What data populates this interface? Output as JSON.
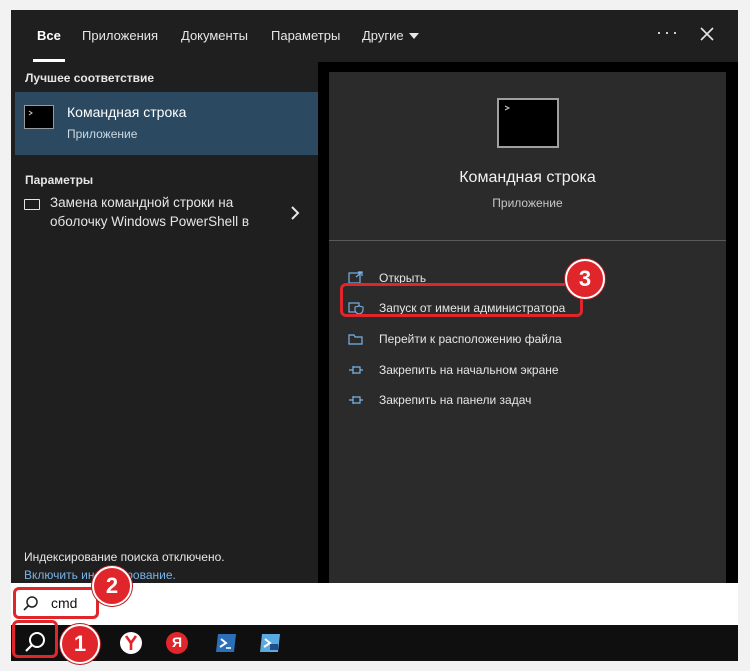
{
  "tabs": [
    {
      "label": "Все",
      "active": true
    },
    {
      "label": "Приложения"
    },
    {
      "label": "Документы"
    },
    {
      "label": "Параметры"
    },
    {
      "label": "Другие"
    }
  ],
  "left": {
    "best_match_heading": "Лучшее соответствие",
    "best_match": {
      "title": "Командная строка",
      "subtitle": "Приложение",
      "icon": "command-prompt-icon"
    },
    "settings_heading": "Параметры",
    "setting_item": {
      "text": "Замена командной строки на оболочку Windows PowerShell в",
      "icon": "monitor-icon"
    },
    "index_notice": "Индексирование поиска отключено.",
    "index_link": "Включить индексирование."
  },
  "right": {
    "app_title": "Командная строка",
    "app_subtitle": "Приложение",
    "actions": [
      {
        "label": "Открыть",
        "icon": "open-icon"
      },
      {
        "label": "Запуск от имени администратора",
        "icon": "shield-icon"
      },
      {
        "label": "Перейти к расположению файла",
        "icon": "folder-icon"
      },
      {
        "label": "Закрепить на начальном экране",
        "icon": "pin-icon"
      },
      {
        "label": "Закрепить на панели задач",
        "icon": "pin-icon"
      }
    ]
  },
  "search": {
    "value": "cmd",
    "icon": "search-icon"
  },
  "taskbar": [
    {
      "name": "search-icon"
    },
    {
      "name": "yandex-browser-icon"
    },
    {
      "name": "yandex-icon",
      "label": "Я"
    },
    {
      "name": "powershell-icon"
    },
    {
      "name": "powershell-ise-icon"
    }
  ],
  "annotations": {
    "step1": "1",
    "step2": "2",
    "step3": "3"
  },
  "colors": {
    "accent_highlight": "#2b4a62",
    "annotation_red": "#e0262b",
    "link": "#7ab2e6"
  }
}
